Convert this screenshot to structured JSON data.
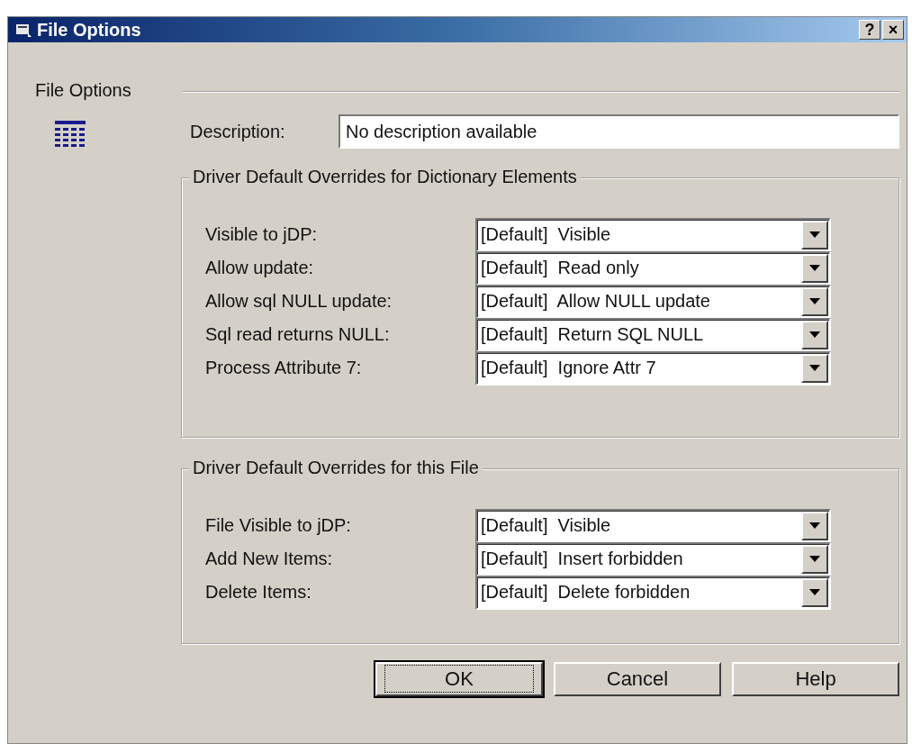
{
  "window": {
    "title": "File Options",
    "controls": [
      "?",
      "×"
    ]
  },
  "sidebar": {
    "label": "File Options"
  },
  "description": {
    "label": "Description:",
    "value": "No description available"
  },
  "groups": [
    {
      "title": "Driver Default Overrides for Dictionary Elements",
      "fields": [
        {
          "label": "Visible to jDP:",
          "value": "[Default]  Visible"
        },
        {
          "label": "Allow update:",
          "value": "[Default]  Read only"
        },
        {
          "label": "Allow sql NULL update:",
          "value": "[Default]  Allow NULL update"
        },
        {
          "label": "Sql read returns NULL:",
          "value": "[Default]  Return SQL NULL"
        },
        {
          "label": "Process Attribute 7:",
          "value": "[Default]  Ignore Attr 7"
        }
      ]
    },
    {
      "title": "Driver Default Overrides for this File",
      "fields": [
        {
          "label": "File Visible to jDP:",
          "value": "[Default]  Visible"
        },
        {
          "label": "Add New Items:",
          "value": "[Default]  Insert forbidden"
        },
        {
          "label": "Delete Items:",
          "value": "[Default]  Delete forbidden"
        }
      ]
    }
  ],
  "buttons": [
    {
      "label": "OK",
      "default": true
    },
    {
      "label": "Cancel",
      "default": false
    },
    {
      "label": "Help",
      "default": false
    }
  ]
}
